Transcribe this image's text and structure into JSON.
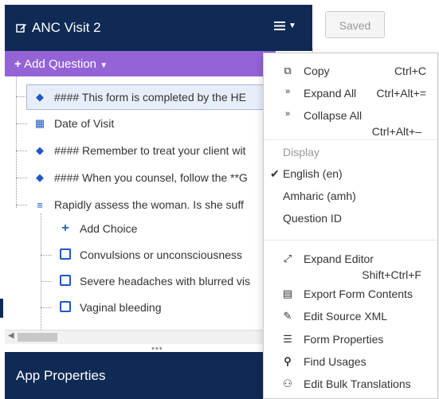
{
  "header": {
    "title": "ANC Visit 2",
    "menu_icon": "hamburger-icon"
  },
  "saved_label": "Saved",
  "add_question_label": "Add Question",
  "tree": [
    {
      "icon": "tag-icon",
      "label": "#### This form is completed by the HE",
      "selected": true
    },
    {
      "icon": "calendar-icon",
      "label": "Date of Visit"
    },
    {
      "icon": "tag-icon",
      "label": "#### Remember to treat your client wit"
    },
    {
      "icon": "tag-icon",
      "label": "#### When you counsel, follow the **G"
    },
    {
      "icon": "checklist-icon",
      "label": "Rapidly assess the woman. Is she suff"
    },
    {
      "icon": "plus-icon",
      "label": "Add Choice"
    },
    {
      "icon": "choice-icon",
      "label": "Convulsions or unconsciousness"
    },
    {
      "icon": "choice-icon",
      "label": "Severe headaches with blurred vis"
    },
    {
      "icon": "choice-icon",
      "label": "Vaginal bleeding"
    }
  ],
  "app_properties_label": "App Properties",
  "menu": {
    "copy": {
      "label": "Copy",
      "shortcut": "Ctrl+C"
    },
    "expand_all": {
      "label": "Expand All",
      "shortcut": "Ctrl+Alt+="
    },
    "collapse_all": {
      "label": "Collapse All",
      "shortcut": "Ctrl+Alt+–"
    },
    "display_header": "Display",
    "lang_en": "English (en)",
    "lang_amh": "Amharic (amh)",
    "question_id": "Question ID",
    "expand_editor": {
      "label": "Expand Editor",
      "shortcut": "Shift+Ctrl+F"
    },
    "export_form_contents": "Export Form Contents",
    "edit_source_xml": "Edit Source XML",
    "form_properties": "Form Properties",
    "find_usages": "Find Usages",
    "edit_bulk_translations": "Edit Bulk Translations"
  },
  "colors": {
    "navy": "#0f2a54",
    "purple": "#9463d6",
    "icon_blue": "#1f57c7"
  }
}
